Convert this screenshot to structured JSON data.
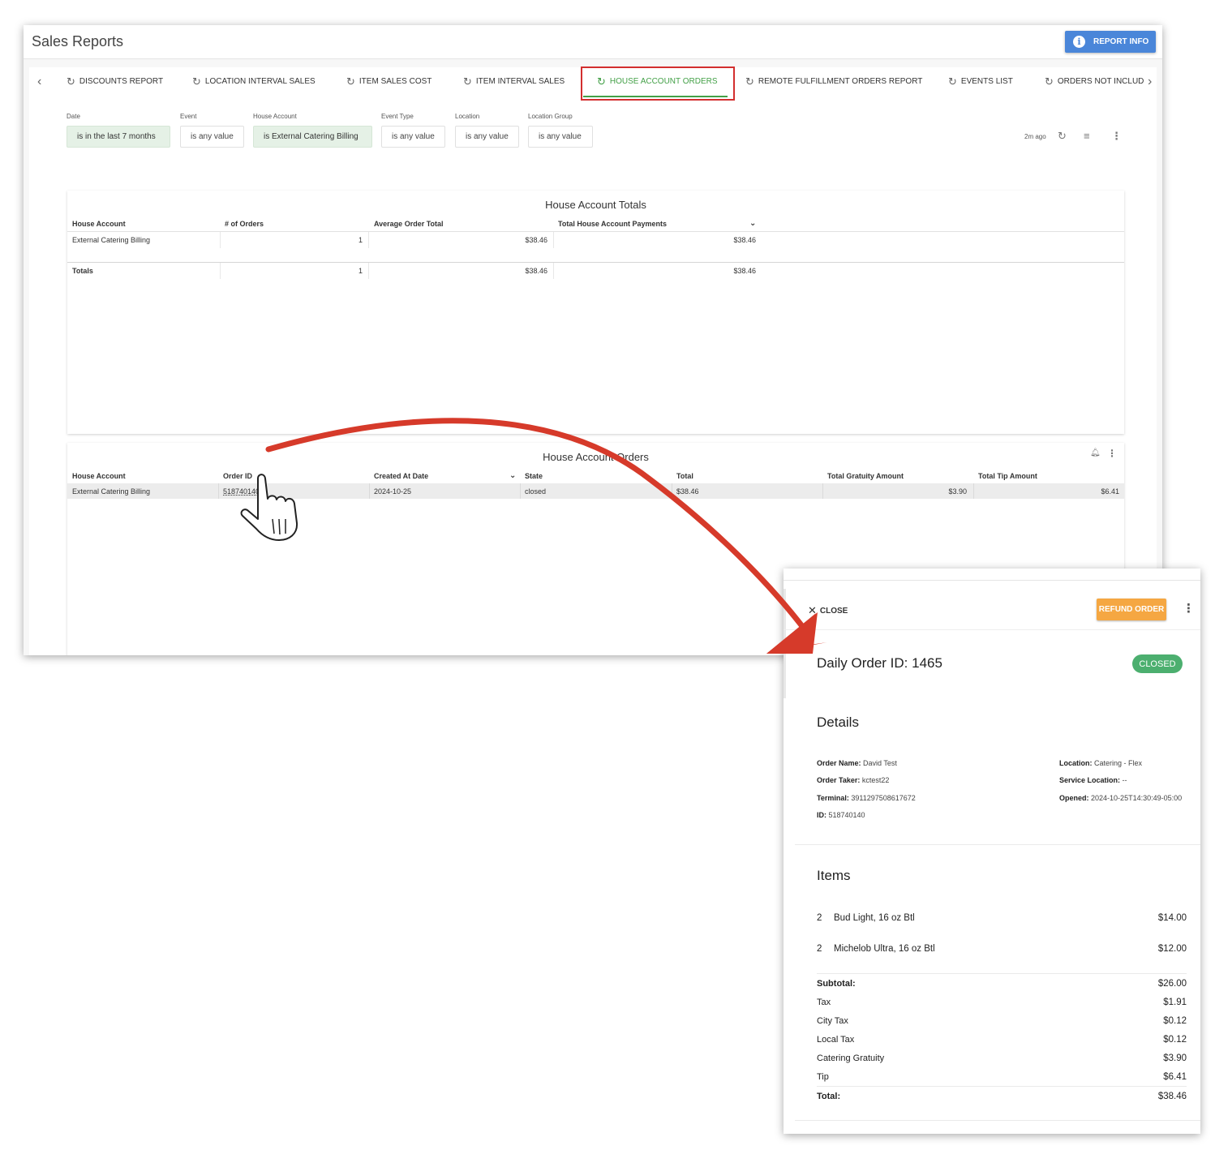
{
  "app": {
    "title": "Sales Reports",
    "report_info_label": "REPORT INFO",
    "report_info_icon": "info-icon"
  },
  "tabs": [
    {
      "label": "DISCOUNTS REPORT",
      "active": false
    },
    {
      "label": "LOCATION INTERVAL SALES",
      "active": false
    },
    {
      "label": "ITEM SALES COST",
      "active": false
    },
    {
      "label": "ITEM INTERVAL SALES",
      "active": false
    },
    {
      "label": "HOUSE ACCOUNT ORDERS",
      "active": true
    },
    {
      "label": "REMOTE FULFILLMENT ORDERS REPORT",
      "active": false
    },
    {
      "label": "EVENTS LIST",
      "active": false
    },
    {
      "label": "ORDERS NOT INCLUD",
      "active": false
    }
  ],
  "filters": [
    {
      "label": "Date",
      "value": "is in the last 7 months",
      "highlighted": true
    },
    {
      "label": "Event",
      "value": "is any value",
      "highlighted": false
    },
    {
      "label": "House Account",
      "value": "is External Catering Billing",
      "highlighted": true
    },
    {
      "label": "Event Type",
      "value": "is any value",
      "highlighted": false
    },
    {
      "label": "Location",
      "value": "is any value",
      "highlighted": false
    },
    {
      "label": "Location Group",
      "value": "is any value",
      "highlighted": false
    }
  ],
  "toolbar": {
    "last_updated": "2m ago"
  },
  "totals_table": {
    "title": "House Account Totals",
    "columns": [
      "House Account",
      "# of Orders",
      "Average Order Total",
      "Total House Account Payments"
    ],
    "rows": [
      [
        "External Catering Billing",
        "1",
        "$38.46",
        "$38.46"
      ]
    ],
    "totals_row": [
      "Totals",
      "1",
      "$38.46",
      "$38.46"
    ]
  },
  "orders_table": {
    "title": "House Account Orders",
    "columns": [
      "House Account",
      "Order ID",
      "Created At Date",
      "State",
      "Total",
      "Total Gratuity Amount",
      "Total Tip Amount"
    ],
    "rows": [
      [
        "External Catering Billing",
        "518740140",
        "2024-10-25",
        "closed",
        "$38.46",
        "$3.90",
        "$6.41"
      ]
    ]
  },
  "order_panel": {
    "close_label": "CLOSE",
    "refund_label": "REFUND ORDER",
    "title": "Daily Order ID: 1465",
    "status": "CLOSED",
    "status_color": "#4caf6f",
    "details_title": "Details",
    "details_left": [
      {
        "label": "Order Name:",
        "value": "David Test"
      },
      {
        "label": "Order Taker:",
        "value": "kctest22"
      },
      {
        "label": "Terminal:",
        "value": "3911297508617672"
      },
      {
        "label": "ID:",
        "value": "518740140"
      }
    ],
    "details_right": [
      {
        "label": "Location:",
        "value": "Catering - Flex"
      },
      {
        "label": "Service Location:",
        "value": "--"
      },
      {
        "label": "Opened:",
        "value": "2024-10-25T14:30:49-05:00"
      }
    ],
    "items_title": "Items",
    "items": [
      {
        "qty": "2",
        "name": "Bud Light, 16 oz Btl",
        "amount": "$14.00"
      },
      {
        "qty": "2",
        "name": "Michelob Ultra, 16 oz Btl",
        "amount": "$12.00"
      }
    ],
    "summary": [
      {
        "label": "Subtotal:",
        "amount": "$26.00",
        "bold": true
      },
      {
        "label": "Tax",
        "amount": "$1.91",
        "bold": false
      },
      {
        "label": "City Tax",
        "amount": "$0.12",
        "bold": false
      },
      {
        "label": "Local Tax",
        "amount": "$0.12",
        "bold": false
      },
      {
        "label": "Catering Gratuity",
        "amount": "$3.90",
        "bold": false
      },
      {
        "label": "Tip",
        "amount": "$6.41",
        "bold": false
      },
      {
        "label": "Total:",
        "amount": "$38.46",
        "bold": true
      }
    ]
  },
  "colors": {
    "accent_green": "#43a047",
    "highlight_red": "#d32f2f",
    "report_info_blue": "#4a86d9",
    "refund_orange": "#f5a742"
  }
}
